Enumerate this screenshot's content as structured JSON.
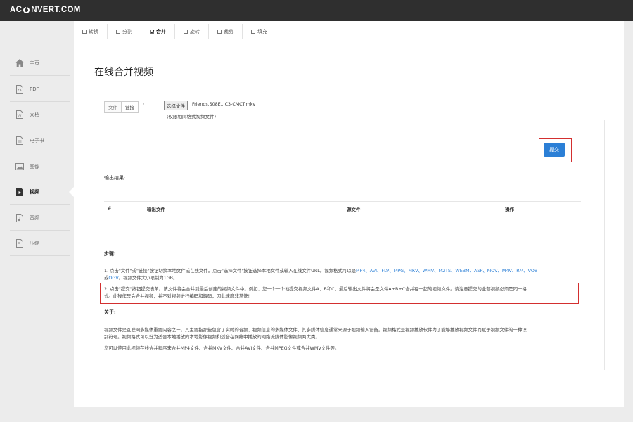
{
  "app": {
    "logo_left": "AC",
    "logo_right": "NVERT.COM"
  },
  "tabs": [
    {
      "label": "转换",
      "active": false
    },
    {
      "label": "分割",
      "active": false
    },
    {
      "label": "合并",
      "active": true
    },
    {
      "label": "旋转",
      "active": false
    },
    {
      "label": "裁剪",
      "active": false
    },
    {
      "label": "填充",
      "active": false
    }
  ],
  "sidebar": [
    {
      "label": "主页",
      "icon": "home-icon"
    },
    {
      "label": "PDF",
      "icon": "pdf-icon"
    },
    {
      "label": "文档",
      "icon": "document-icon"
    },
    {
      "label": "电子书",
      "icon": "ebook-icon"
    },
    {
      "label": "图像",
      "icon": "image-icon"
    },
    {
      "label": "视频",
      "icon": "video-icon",
      "active": true
    },
    {
      "label": "音频",
      "icon": "audio-icon"
    },
    {
      "label": "压缩",
      "icon": "archive-icon"
    }
  ],
  "main": {
    "title": "在线合并视频",
    "source_tabs": [
      "文件",
      "链接"
    ],
    "colon": ":",
    "choose_file": "选择文件",
    "file_name": "Friends.S08E...C3-CMCT.mkv",
    "file_hint": "(仅限相同格式视频文件)",
    "submit": "提交",
    "output_label": "输出结果:",
    "table_headers": [
      "#",
      "输出文件",
      "源文件",
      "操作"
    ],
    "steps_title": "步骤:",
    "step1_a": "1. 点击\"文件\"或\"链接\"按钮切换本地文件或在线文件。点击\"选择文件\"按钮选择本地文件或输入在线文件URL。视频格式可以是",
    "step1_formats": "MP4、AVI、FLV、MPG、MKV、WMV、M2TS、WEBM、ASP、MOV、M4V、RM、VOB",
    "step1_or": "或",
    "step1_ogv": "OGV",
    "step1_b": "。视频文件大小限制为1GB。",
    "step2_a": "2. 点击\"提交\"按钮提交表单。该文件将会合并到最后创建的视频文件中。例如：您一个一个地提交视频文件A、B和C，最后输出文件将会是文件A+B+C合并在一起的视频文件。请注意提交的全部视频必须是同一格",
    "step2_b": "式。此操作只会合并视频，并不对视频进行编码和解码，因此速度非常快!",
    "about_title": "关于:",
    "about_1a": "视频文件是互联网多媒体重要内容之一。其主要指那些包含了实时的音频、视频信息的多媒体文件，其多媒体信息通常来源于视频输入设备。视频格式是视频播放软件为了能够播放视频文件而赋予视频文件的一种识",
    "about_1b": "别符号。视频格式可以分为适合本地播放的本地影像视频和适合在网络中播放的网络流媒体影像视频两大类。",
    "about_2": "您可以使用此视频在线合并程序来合并MP4文件、合并MKV文件、合并AVI文件、合并MPEG文件或合并WMV文件等。"
  },
  "colors": {
    "accent": "#2b7fd6",
    "highlight": "#d32f2f",
    "topbar": "#2f2f2f"
  }
}
